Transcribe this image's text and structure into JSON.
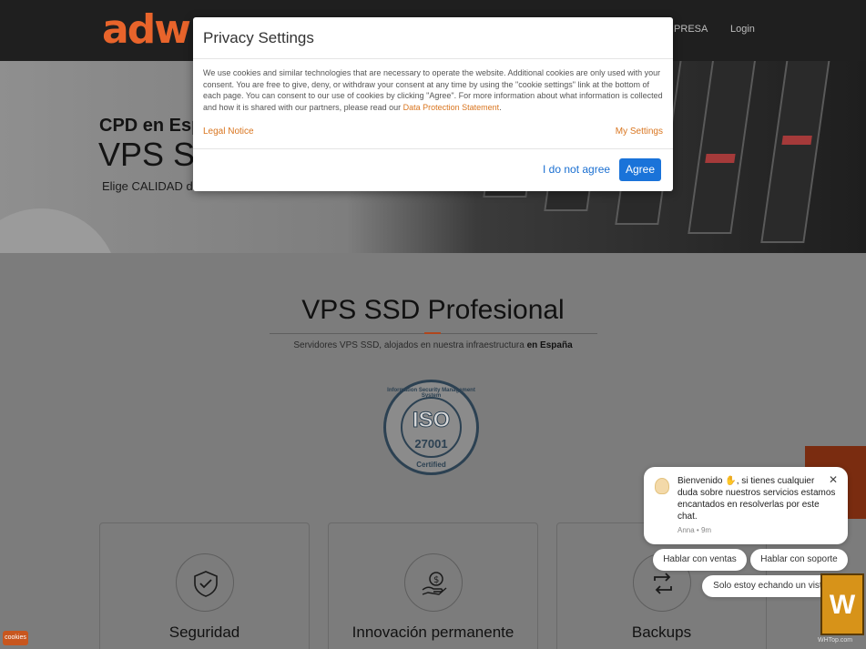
{
  "header": {
    "logo_text": "adw",
    "nav": {
      "empresa_partial": "IPRESA",
      "login": "Login"
    }
  },
  "hero": {
    "line1_partial": "CPD en Esp",
    "line2_partial": "VPS SS",
    "line3_partial": "Elige CALIDAD de "
  },
  "main": {
    "title": "VPS SSD Profesional",
    "subtitle_prefix": "Servidores VPS SSD, alojados en nuestra infraestructura ",
    "subtitle_bold": "en España",
    "iso_badge": {
      "ring_text": "Information Security Management System",
      "logo": "ISO",
      "number": "27001",
      "bottom": "Certified"
    },
    "cards": [
      {
        "title": "Seguridad",
        "icon": "shield-check-icon"
      },
      {
        "title": "Innovación permanente",
        "icon": "money-bag-hand-icon"
      },
      {
        "title": "Backups",
        "icon": "sync-arrows-icon"
      }
    ]
  },
  "privacy_modal": {
    "title": "Privacy Settings",
    "body": "We use cookies and similar technologies that are necessary to operate the website. Additional cookies are only used with your consent. You are free to give, deny, or withdraw your consent at any time by using the \"cookie settings\" link at the bottom of each page. You can consent to our use of cookies by clicking \"Agree\". For more information about what information is collected and how it is shared with our partners, please read our ",
    "body_link": "Data Protection Statement",
    "body_end": ".",
    "legal_notice": "Legal Notice",
    "my_settings": "My Settings",
    "decline": "I do not agree",
    "agree": "Agree"
  },
  "chat": {
    "message": "Bienvenido ✋, si tienes cualquier duda sobre nuestros servicios estamos encantados en resolverlas por este chat.",
    "agent": "Anna",
    "time": "9m",
    "chips": [
      "Hablar con ventas",
      "Hablar con soporte",
      "Solo estoy echando un vistazo"
    ]
  },
  "cookie_tab": "cookies",
  "watermark": {
    "glyph": "W",
    "label": "WHTop.com"
  },
  "colors": {
    "accent": "#e8642b",
    "link": "#d9751f",
    "agree_button": "#1a73d9"
  }
}
